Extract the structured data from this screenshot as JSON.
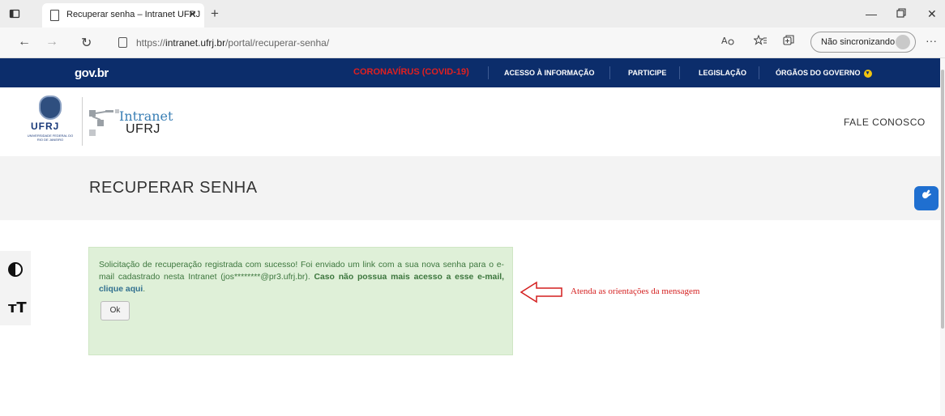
{
  "browser": {
    "tab_title": "Recuperar senha – Intranet UFRJ",
    "tab_close": "✕",
    "new_tab": "+",
    "url_prefix": "https://",
    "url_host": "intranet.ufrj.br",
    "url_path": "/portal/recuperar-senha/",
    "sync_label": "Não sincronizando",
    "more": "···"
  },
  "govbar": {
    "logo": "gov.br",
    "links": {
      "covid": "CORONAVÍRUS (COVID-19)",
      "acesso": "ACESSO À INFORMAÇÃO",
      "participe": "PARTICIPE",
      "legislacao": "LEGISLAÇÃO",
      "orgaos": "ÓRGÃOS DO GOVERNO"
    }
  },
  "header": {
    "ufrj_logo_text": "UFRJ",
    "ufrj_logo_subtext": "UNIVERSIDADE FEDERAL DO RIO DE JANEIRO",
    "intranet_title": "Intranet",
    "intranet_sub": "UFRJ",
    "fale_conosco": "FALE CONOSCO"
  },
  "page": {
    "title": "RECUPERAR SENHA"
  },
  "message": {
    "text_part1": "Solicitação de recuperação registrada com sucesso! Foi enviado um link com a sua nova senha para o e-mail cadastrado nesta Intranet (jos********@pr3.ufrj.br). ",
    "text_bold": "Caso não possua mais acesso a esse e-mail,",
    "link": "clique aqui",
    "text_end": ".",
    "ok_label": "Ok"
  },
  "annotation": {
    "text": "Atenda as orientações da mensagem",
    "color": "#d41f1f"
  },
  "colors": {
    "govbar_bg": "#0c2d6b",
    "success_bg": "#dff0d8",
    "success_text": "#3c763d"
  }
}
